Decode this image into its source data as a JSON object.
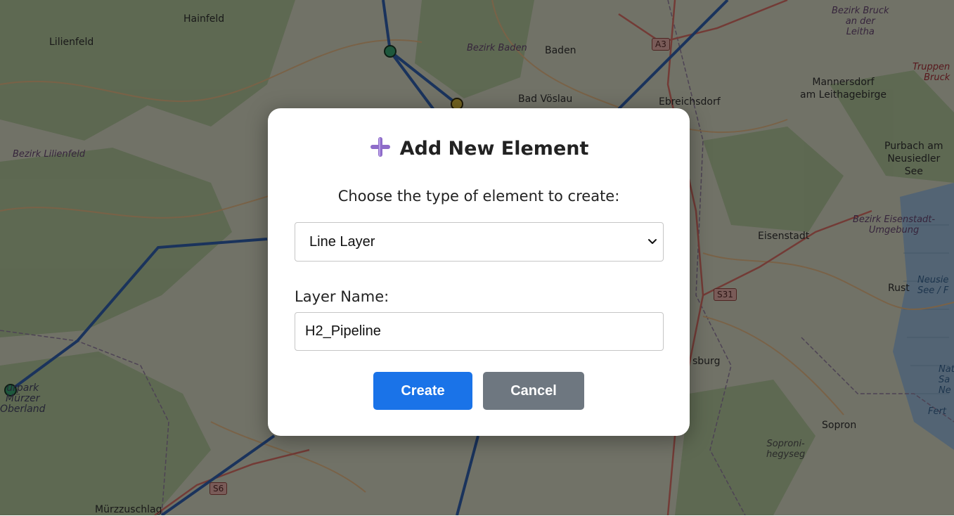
{
  "map": {
    "places": [
      {
        "id": "hainfeld",
        "label": "Hainfeld"
      },
      {
        "id": "lilienfeld",
        "label": "Lilienfeld"
      },
      {
        "id": "baden",
        "label": "Baden"
      },
      {
        "id": "bad-voslau",
        "label": "Bad Vöslau"
      },
      {
        "id": "ebreichsdorf",
        "label": "Ebreichsdorf"
      },
      {
        "id": "mannersdorf",
        "label": "Mannersdorf\nam Leithagebirge"
      },
      {
        "id": "purbach",
        "label": "Purbach am\nNeusiedler\nSee"
      },
      {
        "id": "eisenstadt",
        "label": "Eisenstadt"
      },
      {
        "id": "rust",
        "label": "Rust"
      },
      {
        "id": "sopron",
        "label": "Sopron"
      },
      {
        "id": "murzzuschlag",
        "label": "Mürzzuschlag"
      },
      {
        "id": "naturpark",
        "label": "urpark\nMürzer\nOberland"
      },
      {
        "id": "sopron-hegyseg",
        "label": "Soproni-\nhegyseg"
      },
      {
        "id": "sburg",
        "label": "sburg"
      }
    ],
    "districts": [
      {
        "id": "bruck",
        "label": "Bezirk Bruck\nan der\nLeitha"
      },
      {
        "id": "bezirk-baden",
        "label": "Bezirk Baden"
      },
      {
        "id": "bezirk-lilienfeld",
        "label": "Bezirk Lilienfeld"
      },
      {
        "id": "eisenstadt-umgebung",
        "label": "Bezirk Eisenstadt-\nUmgebung"
      },
      {
        "id": "truppen",
        "label": "Truppen\nBruck"
      },
      {
        "id": "neusiedler-see",
        "label": "Neusie\nSee / F"
      },
      {
        "id": "fert",
        "label": "Fert"
      },
      {
        "id": "nat",
        "label": "Nat\nSa\nNe"
      }
    ],
    "roads": [
      {
        "id": "a3",
        "label": "A3"
      },
      {
        "id": "s31",
        "label": "S31"
      },
      {
        "id": "s6",
        "label": "S6"
      }
    ]
  },
  "dialog": {
    "title": "Add New Element",
    "prompt": "Choose the type of element to create:",
    "type_select": {
      "selected": "Line Layer",
      "options": [
        "Line Layer"
      ]
    },
    "name_label": "Layer Name:",
    "name_value": "H2_Pipeline",
    "create_label": "Create",
    "cancel_label": "Cancel"
  }
}
